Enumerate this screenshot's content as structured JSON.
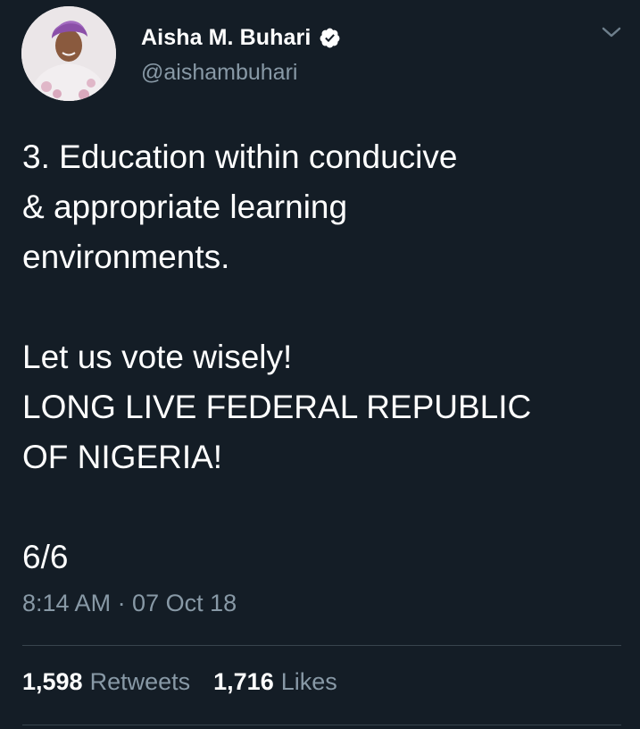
{
  "tweet": {
    "author": {
      "display_name": "Aisha M. Buhari",
      "handle": "@aishambuhari",
      "verified_icon": "verified-badge-icon",
      "avatar_icon": "avatar"
    },
    "menu_icon": "chevron-down-icon",
    "text": "3. Education within conducive\n& appropriate learning\nenvironments.\n\nLet us vote wisely!\nLONG LIVE FEDERAL REPUBLIC\nOF NIGERIA!\n\n6/6",
    "timestamp": "8:14 AM · 07 Oct 18",
    "stats": {
      "retweets_count": "1,598",
      "retweets_label": "Retweets",
      "likes_count": "1,716",
      "likes_label": "Likes"
    }
  },
  "colors": {
    "background": "#141d26",
    "primary_text": "#ffffff",
    "secondary_text": "#8899a6",
    "divider": "#38444d"
  }
}
